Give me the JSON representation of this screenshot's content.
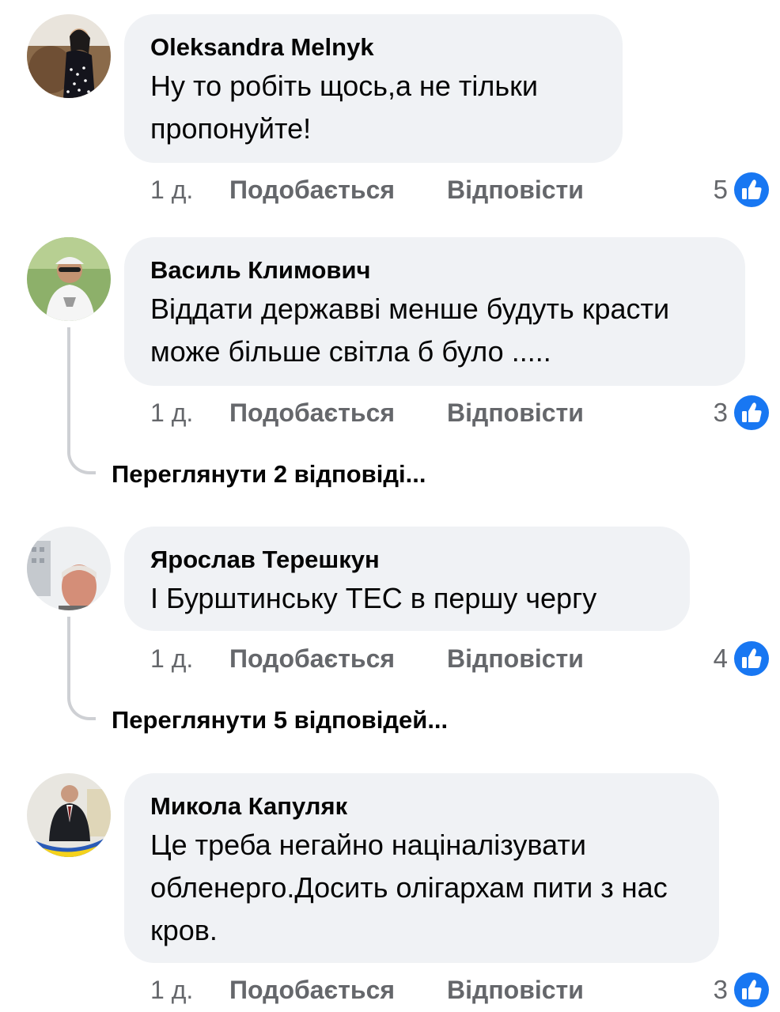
{
  "like_icon": "thumbs-up-icon",
  "colors": {
    "like_blue": "#1877f2",
    "bubble_bg": "#f0f2f5",
    "meta_text": "#65676b",
    "thread_line": "#ced0d4"
  },
  "comments": [
    {
      "author": "Oleksandra Melnyk",
      "text": "Ну то робіть щось,а не тільки пропонуйте!",
      "time": "1 д.",
      "like_label": "Подобається",
      "reply_label": "Відповісти",
      "reactions": "5"
    },
    {
      "author": "Василь Климович",
      "text": "Віддати державві менше будуть красти може більше світла б було .....",
      "time": "1 д.",
      "like_label": "Подобається",
      "reply_label": "Відповісти",
      "reactions": "3",
      "view_replies": "Переглянути 2 відповіді..."
    },
    {
      "author": "Ярослав Терешкун",
      "text": "І Бурштинську ТЕС в першу чергу",
      "time": "1 д.",
      "like_label": "Подобається",
      "reply_label": "Відповісти",
      "reactions": "4",
      "view_replies": "Переглянути 5 відповідей..."
    },
    {
      "author": "Микола Капуляк",
      "text": "Це треба негайно націналізувати обленерго.Досить олігархам пити з нас кров.",
      "time": "1 д.",
      "like_label": "Подобається",
      "reply_label": "Відповісти",
      "reactions": "3"
    }
  ]
}
